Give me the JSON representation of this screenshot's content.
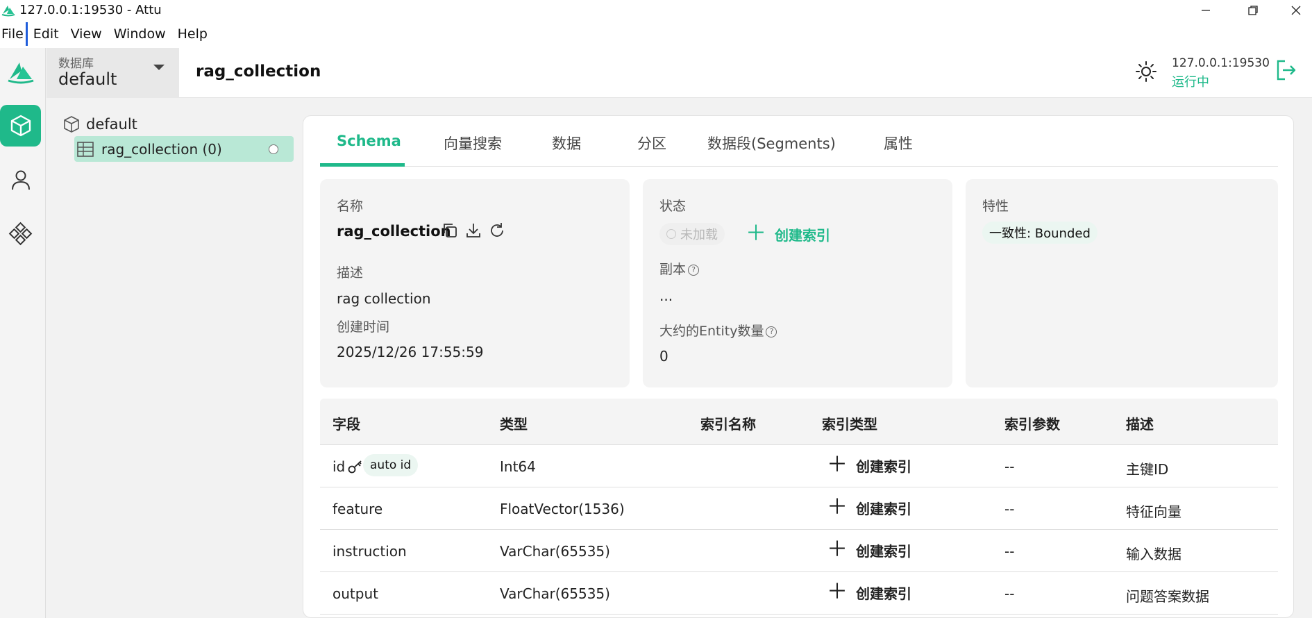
{
  "window": {
    "title": "127.0.0.1:19530 - Attu"
  },
  "menu": [
    "File",
    "Edit",
    "View",
    "Window",
    "Help"
  ],
  "database": {
    "label": "数据库",
    "value": "default"
  },
  "header": {
    "title": "rag_collection",
    "address": "127.0.0.1:19530",
    "status": "运行中"
  },
  "tree": {
    "db": "default",
    "collection": "rag_collection (0)"
  },
  "tabs": [
    "Schema",
    "向量搜索",
    "数据",
    "分区",
    "数据段(Segments)",
    "属性"
  ],
  "info": {
    "name_label": "名称",
    "name": "rag_collection",
    "desc_label": "描述",
    "desc": "rag collection",
    "created_label": "创建时间",
    "created": "2025/12/26 17:55:59"
  },
  "status_panel": {
    "label": "状态",
    "load_state": "未加载",
    "create_index": "创建索引",
    "replica_label": "副本",
    "replica_value": "...",
    "entity_label": "大约的Entity数量",
    "entity_value": "0"
  },
  "props": {
    "label": "特性",
    "consistency": "一致性: Bounded"
  },
  "table": {
    "headers": [
      "字段",
      "类型",
      "索引名称",
      "索引类型",
      "索引参数",
      "描述"
    ],
    "rows": [
      {
        "field": "id",
        "badge": "auto id",
        "type": "Int64",
        "action": "创建索引",
        "params": "--",
        "desc": "主键ID"
      },
      {
        "field": "feature",
        "type": "FloatVector(1536)",
        "action": "创建索引",
        "params": "--",
        "desc": "特征向量"
      },
      {
        "field": "instruction",
        "type": "VarChar(65535)",
        "action": "创建索引",
        "params": "--",
        "desc": "输入数据"
      },
      {
        "field": "output",
        "type": "VarChar(65535)",
        "action": "创建索引",
        "params": "--",
        "desc": "问题答案数据"
      }
    ]
  },
  "colors": {
    "accent": "#1fb98a",
    "selection": "#b9e8d6"
  },
  "icons": [
    "attu-logo-icon",
    "minimize-icon",
    "maximize-icon",
    "close-icon",
    "collection-nav-icon",
    "user-nav-icon",
    "settings-nav-icon",
    "theme-toggle-icon",
    "logout-icon",
    "database-icon",
    "table-icon",
    "copy-icon",
    "download-icon",
    "refresh-icon",
    "help-icon",
    "key-icon",
    "plus-icon"
  ]
}
